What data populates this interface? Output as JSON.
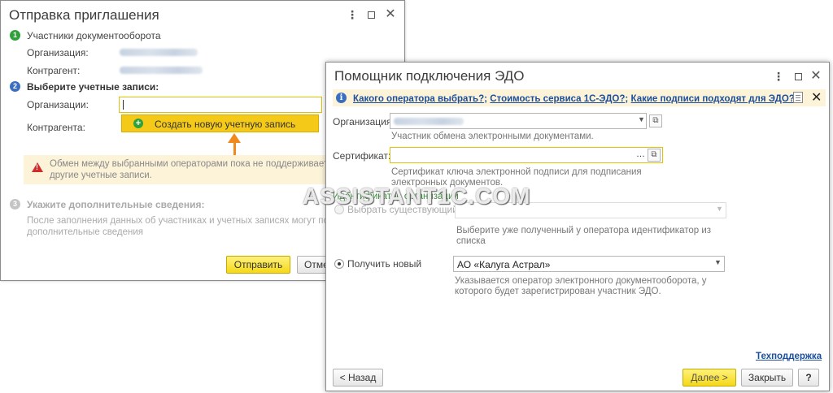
{
  "invite_window": {
    "title": "Отправка приглашения",
    "step1": {
      "number": "1",
      "label": "Участники документооборота",
      "org_label": "Организация:",
      "counterparty_label": "Контрагент:"
    },
    "step2": {
      "number": "2",
      "label": "Выберите учетные записи:",
      "orgs_label": "Организации:",
      "counterparty_label": "Контрагента:",
      "dropdown_item": "Создать новую учетную запись"
    },
    "warning": {
      "line1": "Обмен между выбранными операторами пока не поддерживается. В",
      "line2": "другие учетные записи."
    },
    "step3": {
      "number": "3",
      "label": "Укажите дополнительные сведения:",
      "desc_line1": "После заполнения данных об участниках и учетных записях могут потреб",
      "desc_line2": "дополнительные сведения"
    },
    "send_button": "Отправить",
    "cancel_button": "Отме"
  },
  "edo_wizard": {
    "title": "Помощник подключения ЭДО",
    "info_links": [
      "Какого оператора выбрать?",
      "Стоимость сервиса 1С-ЭДО?",
      "Какие подписи подходят для ЭДО?"
    ],
    "info_sep": ";",
    "org_label": "Организация:",
    "org_hint": "Участник обмена электронными документами.",
    "cert_label": "Сертификат:",
    "cert_hint_line1": "Сертификат ключа электронной подписи для подписания",
    "cert_hint_line2": "электронных документов.",
    "org_id_label": "Идентификатор организации",
    "radio_existing": "Выбрать существующий",
    "existing_hint_line1": "Выберите уже полученный у оператора идентификатор из",
    "existing_hint_line2": "списка",
    "radio_new": "Получить новый",
    "operator_value": "АО «Калуга Астрал»",
    "operator_hint_line1": "Указывается оператор электронного документооборота, у",
    "operator_hint_line2": "которого будет зарегистрирован участник ЭДО.",
    "support_link": "Техподдержка",
    "back_button": "< Назад",
    "next_button": "Далее >",
    "close_button": "Закрыть",
    "help_button": "?"
  },
  "watermark": "ASSISTANT1C.COM",
  "colors": {
    "accent_yellow": "#f5d81a",
    "step_green": "#2fa13a",
    "step_blue": "#3a6ec0",
    "link_blue": "#1b4f9c",
    "arrow_orange": "#f08a1c",
    "warning_red": "#d02a2a"
  }
}
